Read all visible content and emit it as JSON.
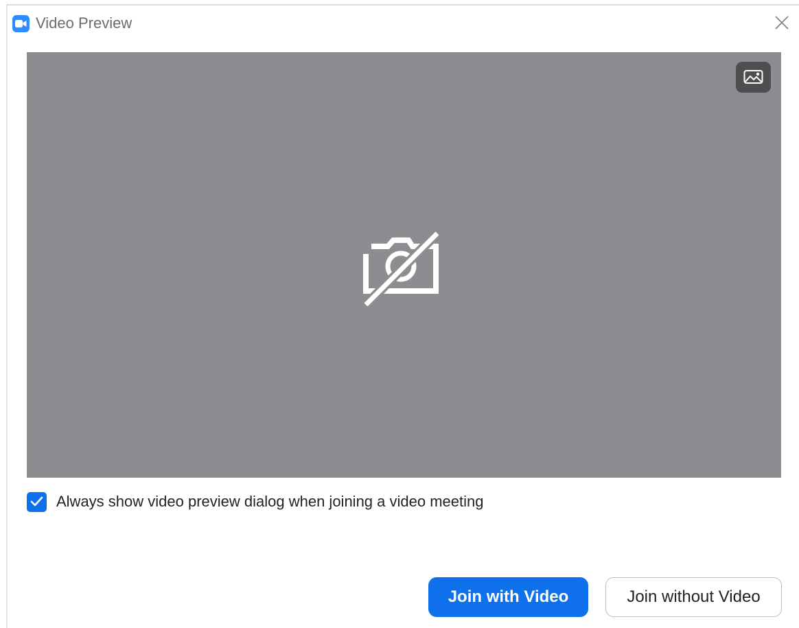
{
  "window": {
    "title": "Video Preview",
    "app_icon": "zoom-video-camera-icon",
    "close_icon": "close-icon"
  },
  "preview": {
    "status_icon": "camera-off-icon",
    "background_button_icon": "background-image-icon",
    "background_color": "#8e8c91"
  },
  "options": {
    "always_show_preview_label": "Always show video preview dialog when joining a video meeting",
    "always_show_preview_checked": true
  },
  "actions": {
    "join_with_video_label": "Join with Video",
    "join_without_video_label": "Join without Video"
  },
  "colors": {
    "accent": "#0e71eb",
    "app_icon": "#2d8cff"
  }
}
